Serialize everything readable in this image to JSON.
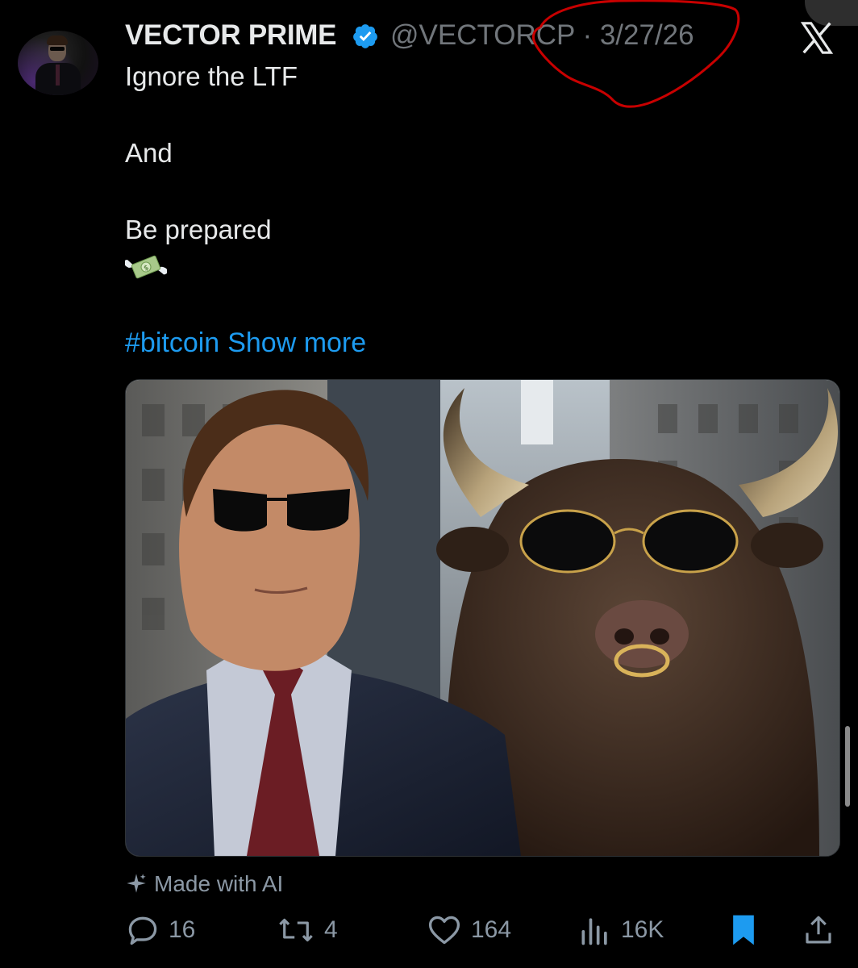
{
  "tweet": {
    "author_name": "VECTOR PRIME",
    "handle_date": "@VECTORCP · 3/27/26",
    "lines": [
      "Ignore the LTF",
      "And",
      "Be prepared"
    ],
    "emoji": "money-with-wings",
    "hashtag": "#bitcoin",
    "show_more": "Show more",
    "ai_label": "Made with AI"
  },
  "metrics": {
    "replies": "16",
    "reposts": "4",
    "likes": "164",
    "views": "16K"
  },
  "colors": {
    "background": "#000000",
    "text": "#e7e9ea",
    "muted": "#71767b",
    "link": "#1d9bf0",
    "verified": "#1d9bf0",
    "bookmark_active": "#1d9bf0",
    "annotation_red": "#c80000"
  },
  "icons": {
    "verified": "verified-badge-icon",
    "platform": "x-logo-icon",
    "ai": "sparkle-icon",
    "reply": "reply-icon",
    "repost": "repost-icon",
    "like": "heart-icon",
    "views": "views-icon",
    "bookmark": "bookmark-icon",
    "share": "share-icon"
  }
}
